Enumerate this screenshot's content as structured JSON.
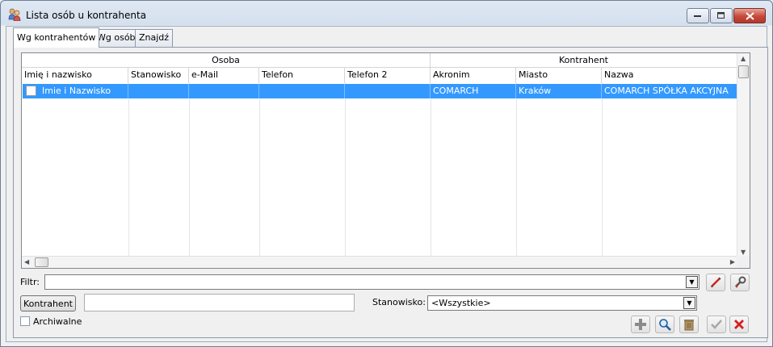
{
  "window": {
    "title": "Lista osób u kontrahenta"
  },
  "tabs": [
    {
      "label": "Wg kontrahentów",
      "active": true
    },
    {
      "label": "Wg osób",
      "active": false
    },
    {
      "label": "Znajdź",
      "active": false
    }
  ],
  "grid": {
    "groups": [
      "Osoba",
      "Kontrahent"
    ],
    "columns": [
      "Imię i nazwisko",
      "Stanowisko",
      "e-Mail",
      "Telefon",
      "Telefon 2",
      "Akronim",
      "Miasto",
      "Nazwa"
    ],
    "rows": [
      {
        "checked": false,
        "name": "Imie i Nazwisko",
        "position": "",
        "email": "",
        "phone": "",
        "phone2": "",
        "acronym": "COMARCH",
        "city": "Kraków",
        "company": "COMARCH SPÓŁKA AKCYJNA"
      }
    ]
  },
  "filter": {
    "label": "Filtr:",
    "value": ""
  },
  "contractor": {
    "button_label": "Kontrahent",
    "value": ""
  },
  "position_filter": {
    "label": "Stanowisko:",
    "selected": "<Wszystkie>"
  },
  "archive": {
    "label": "Archiwalne",
    "checked": false
  },
  "colors": {
    "selection": "#3399ff",
    "close_button": "#c6483a"
  },
  "icons": {
    "title": "contacts-icon",
    "filter_clear": "clear-filter-icon",
    "filter_build": "filter-wrench-icon",
    "add": "plus-icon",
    "preview": "magnifier-icon",
    "delete": "trash-icon",
    "confirm": "checkmark-icon",
    "cancel": "close-x-icon"
  }
}
